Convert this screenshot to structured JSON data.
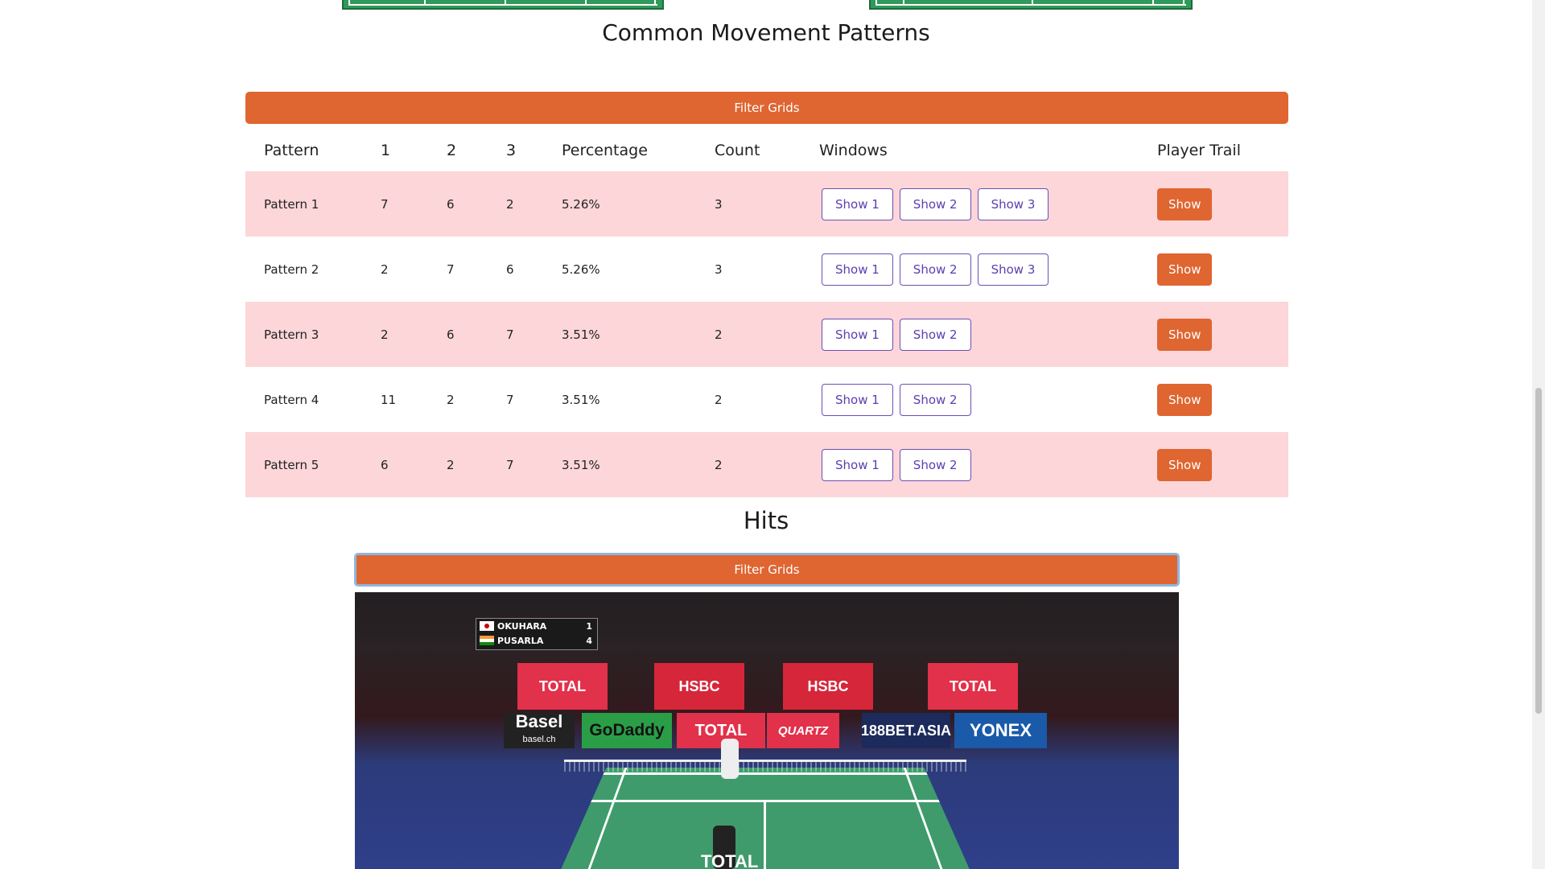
{
  "patterns_section": {
    "title": "Common Movement Patterns",
    "filter_label": "Filter Grids",
    "headers": [
      "Pattern",
      "1",
      "2",
      "3",
      "Percentage",
      "Count",
      "Windows",
      "Player Trail"
    ],
    "rows": [
      {
        "name": "Pattern 1",
        "c1": "7",
        "c2": "6",
        "c3": "2",
        "percentage": "5.26%",
        "count": "3",
        "windows": [
          "Show 1",
          "Show 2",
          "Show 3"
        ],
        "trail": "Show"
      },
      {
        "name": "Pattern 2",
        "c1": "2",
        "c2": "7",
        "c3": "6",
        "percentage": "5.26%",
        "count": "3",
        "windows": [
          "Show 1",
          "Show 2",
          "Show 3"
        ],
        "trail": "Show"
      },
      {
        "name": "Pattern 3",
        "c1": "2",
        "c2": "6",
        "c3": "7",
        "percentage": "3.51%",
        "count": "2",
        "windows": [
          "Show 1",
          "Show 2"
        ],
        "trail": "Show"
      },
      {
        "name": "Pattern 4",
        "c1": "11",
        "c2": "2",
        "c3": "7",
        "percentage": "3.51%",
        "count": "2",
        "windows": [
          "Show 1",
          "Show 2"
        ],
        "trail": "Show"
      },
      {
        "name": "Pattern 5",
        "c1": "6",
        "c2": "2",
        "c3": "7",
        "percentage": "3.51%",
        "count": "2",
        "windows": [
          "Show 1",
          "Show 2"
        ],
        "trail": "Show"
      }
    ]
  },
  "hits_section": {
    "title": "Hits",
    "filter_label": "Filter Grids"
  },
  "video": {
    "scoreboard": [
      {
        "player": "OKUHARA",
        "score": "1"
      },
      {
        "player": "PUSARLA",
        "score": "4"
      }
    ],
    "ads": {
      "total": "TOTAL",
      "hsbc": "HSBC",
      "basel": "Basel",
      "basel_sub": "basel.ch",
      "godaddy": "GoDaddy",
      "quartz": "QUARTZ",
      "bet": "188BET.ASIA",
      "yonex": "YONEX"
    }
  },
  "colors": {
    "accent": "#df6531",
    "row_highlight": "#fcd6d8",
    "window_button": "#5b3fb0"
  }
}
